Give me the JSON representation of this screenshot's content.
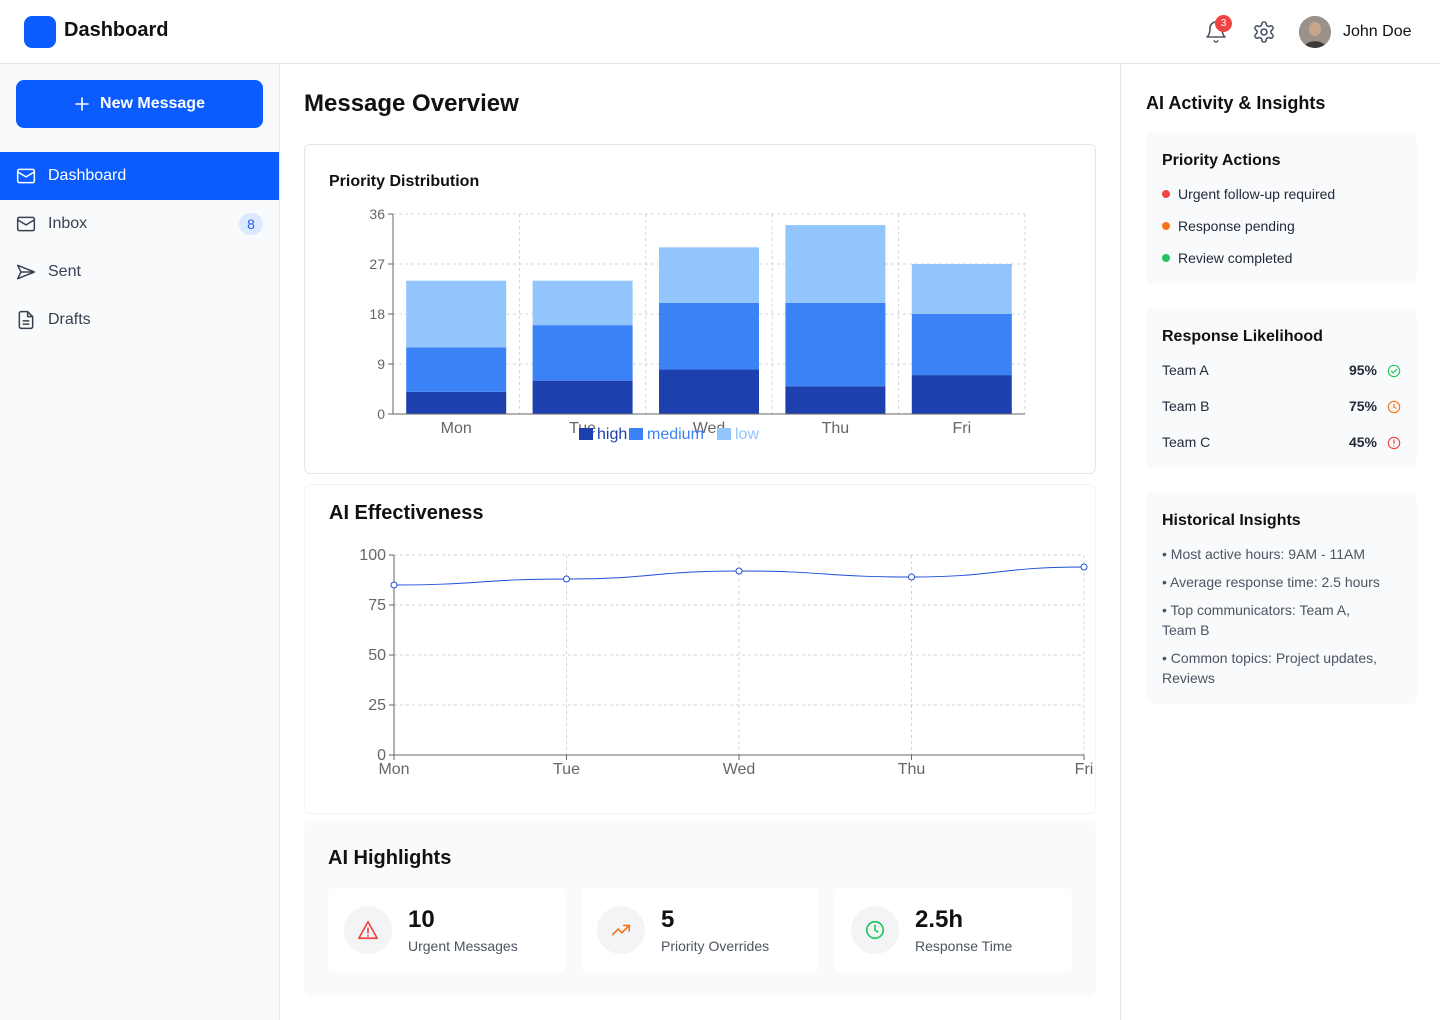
{
  "header": {
    "title": "Dashboard",
    "notification_count": "3",
    "user_name": "John Doe"
  },
  "sidebar": {
    "new_message_label": "New Message",
    "items": [
      {
        "label": "Dashboard",
        "icon": "mail-icon",
        "active": true
      },
      {
        "label": "Inbox",
        "icon": "mail-icon",
        "count": "8"
      },
      {
        "label": "Sent",
        "icon": "send-icon"
      },
      {
        "label": "Drafts",
        "icon": "document-icon"
      }
    ]
  },
  "main": {
    "title": "Message Overview",
    "priority_card_title": "Priority Distribution",
    "effectiveness_card_title": "AI Effectiveness",
    "highlights": {
      "title": "AI Highlights",
      "items": [
        {
          "value": "10",
          "label": "Urgent Messages",
          "icon": "warning-icon",
          "color": "#ef4444"
        },
        {
          "value": "5",
          "label": "Priority Overrides",
          "icon": "trending-up-icon",
          "color": "#f97316"
        },
        {
          "value": "2.5h",
          "label": "Response Time",
          "icon": "clock-icon",
          "color": "#22c55e"
        }
      ]
    }
  },
  "chart_data": [
    {
      "type": "bar",
      "stacked": true,
      "categories": [
        "Mon",
        "Tue",
        "Wed",
        "Thu",
        "Fri"
      ],
      "series": [
        {
          "name": "high",
          "values": [
            4,
            6,
            8,
            5,
            7
          ],
          "color": "#1e40af"
        },
        {
          "name": "medium",
          "values": [
            8,
            10,
            12,
            15,
            11
          ],
          "color": "#3b82f6"
        },
        {
          "name": "low",
          "values": [
            12,
            8,
            10,
            14,
            9
          ],
          "color": "#93c5fd"
        }
      ],
      "yticks": [
        0,
        9,
        18,
        27,
        36
      ],
      "ylim": [
        0,
        36
      ],
      "grid": true,
      "legend": "bottom"
    },
    {
      "type": "line",
      "categories": [
        "Mon",
        "Tue",
        "Wed",
        "Thu",
        "Fri"
      ],
      "series": [
        {
          "name": "",
          "values": [
            85,
            88,
            92,
            89,
            94
          ],
          "color": "#1d4ed8"
        }
      ],
      "yticks": [
        0,
        25,
        50,
        75,
        100
      ],
      "ylim": [
        0,
        100
      ],
      "grid": true
    }
  ],
  "right_panel": {
    "title": "AI Activity & Insights",
    "priority_actions": {
      "title": "Priority Actions",
      "items": [
        {
          "label": "Urgent follow-up required",
          "color": "#ef4444"
        },
        {
          "label": "Response pending",
          "color": "#f97316"
        },
        {
          "label": "Review completed",
          "color": "#22c55e"
        }
      ]
    },
    "response_likelihood": {
      "title": "Response Likelihood",
      "rows": [
        {
          "team": "Team A",
          "pct": "95%",
          "icon": "check-circle-icon",
          "color": "#22c55e"
        },
        {
          "team": "Team B",
          "pct": "75%",
          "icon": "clock-icon",
          "color": "#f97316"
        },
        {
          "team": "Team C",
          "pct": "45%",
          "icon": "alert-circle-icon",
          "color": "#ef4444"
        }
      ]
    },
    "historical_insights": {
      "title": "Historical Insights",
      "items": [
        "• Most active hours: 9AM - 11AM",
        "• Average response time: 2.5 hours",
        "• Top communicators: Team A, Team B",
        "• Common topics: Project updates, Reviews"
      ]
    }
  }
}
